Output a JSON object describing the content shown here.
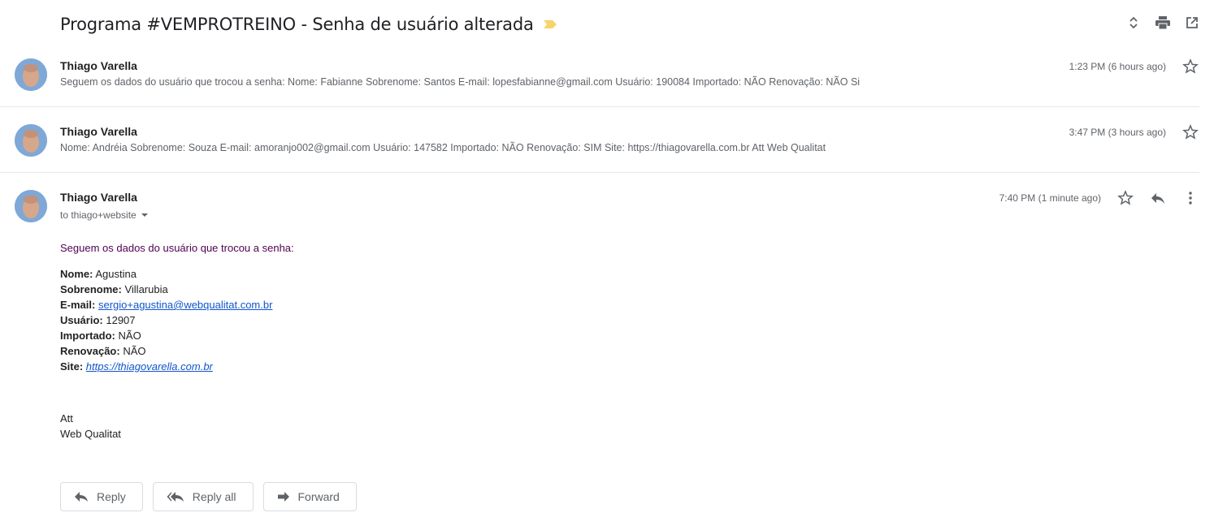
{
  "thread": {
    "subject": "Programa #VEMPROTREINO - Senha de usuário alterada",
    "label_color": "#f8d36a",
    "icons": [
      "expand-collapse-icon",
      "print-icon",
      "open-new-window-icon"
    ]
  },
  "messages": [
    {
      "sender": "Thiago Varella",
      "snippet": "Seguem os dados do usuário que trocou a senha: Nome: Fabianne Sobrenome: Santos E-mail: lopesfabianne@gmail.com Usuário: 190084 Importado: NÃO Renovação: NÃO Si",
      "time": "1:23 PM (6 hours ago)"
    },
    {
      "sender": "Thiago Varella",
      "snippet": "Nome: Andréia Sobrenome: Souza E-mail: amoranjo002@gmail.com Usuário: 147582 Importado: NÃO Renovação: SIM Site: https://thiagovarella.com.br Att Web Qualitat",
      "time": "3:47 PM (3 hours ago)"
    }
  ],
  "open_message": {
    "sender": "Thiago Varella",
    "to": "to thiago+website",
    "time": "7:40 PM (1 minute ago)",
    "intro": "Seguem os dados do usuário que trocou a senha:",
    "fields": {
      "nome_label": "Nome:",
      "nome": "Agustina",
      "sobrenome_label": "Sobrenome:",
      "sobrenome": "Villarubia",
      "email_label": "E-mail:",
      "email": "sergio+agustina@webqualitat.com.br",
      "usuario_label": "Usuário:",
      "usuario": "12907",
      "importado_label": "Importado:",
      "importado": "NÃO",
      "renovacao_label": "Renovação:",
      "renovacao": "NÃO",
      "site_label": "Site:",
      "site": "https://thiagovarella.com.br"
    },
    "signature": {
      "line1": "Att",
      "line2": "Web Qualitat"
    }
  },
  "actions": {
    "reply": "Reply",
    "reply_all": "Reply all",
    "forward": "Forward"
  }
}
